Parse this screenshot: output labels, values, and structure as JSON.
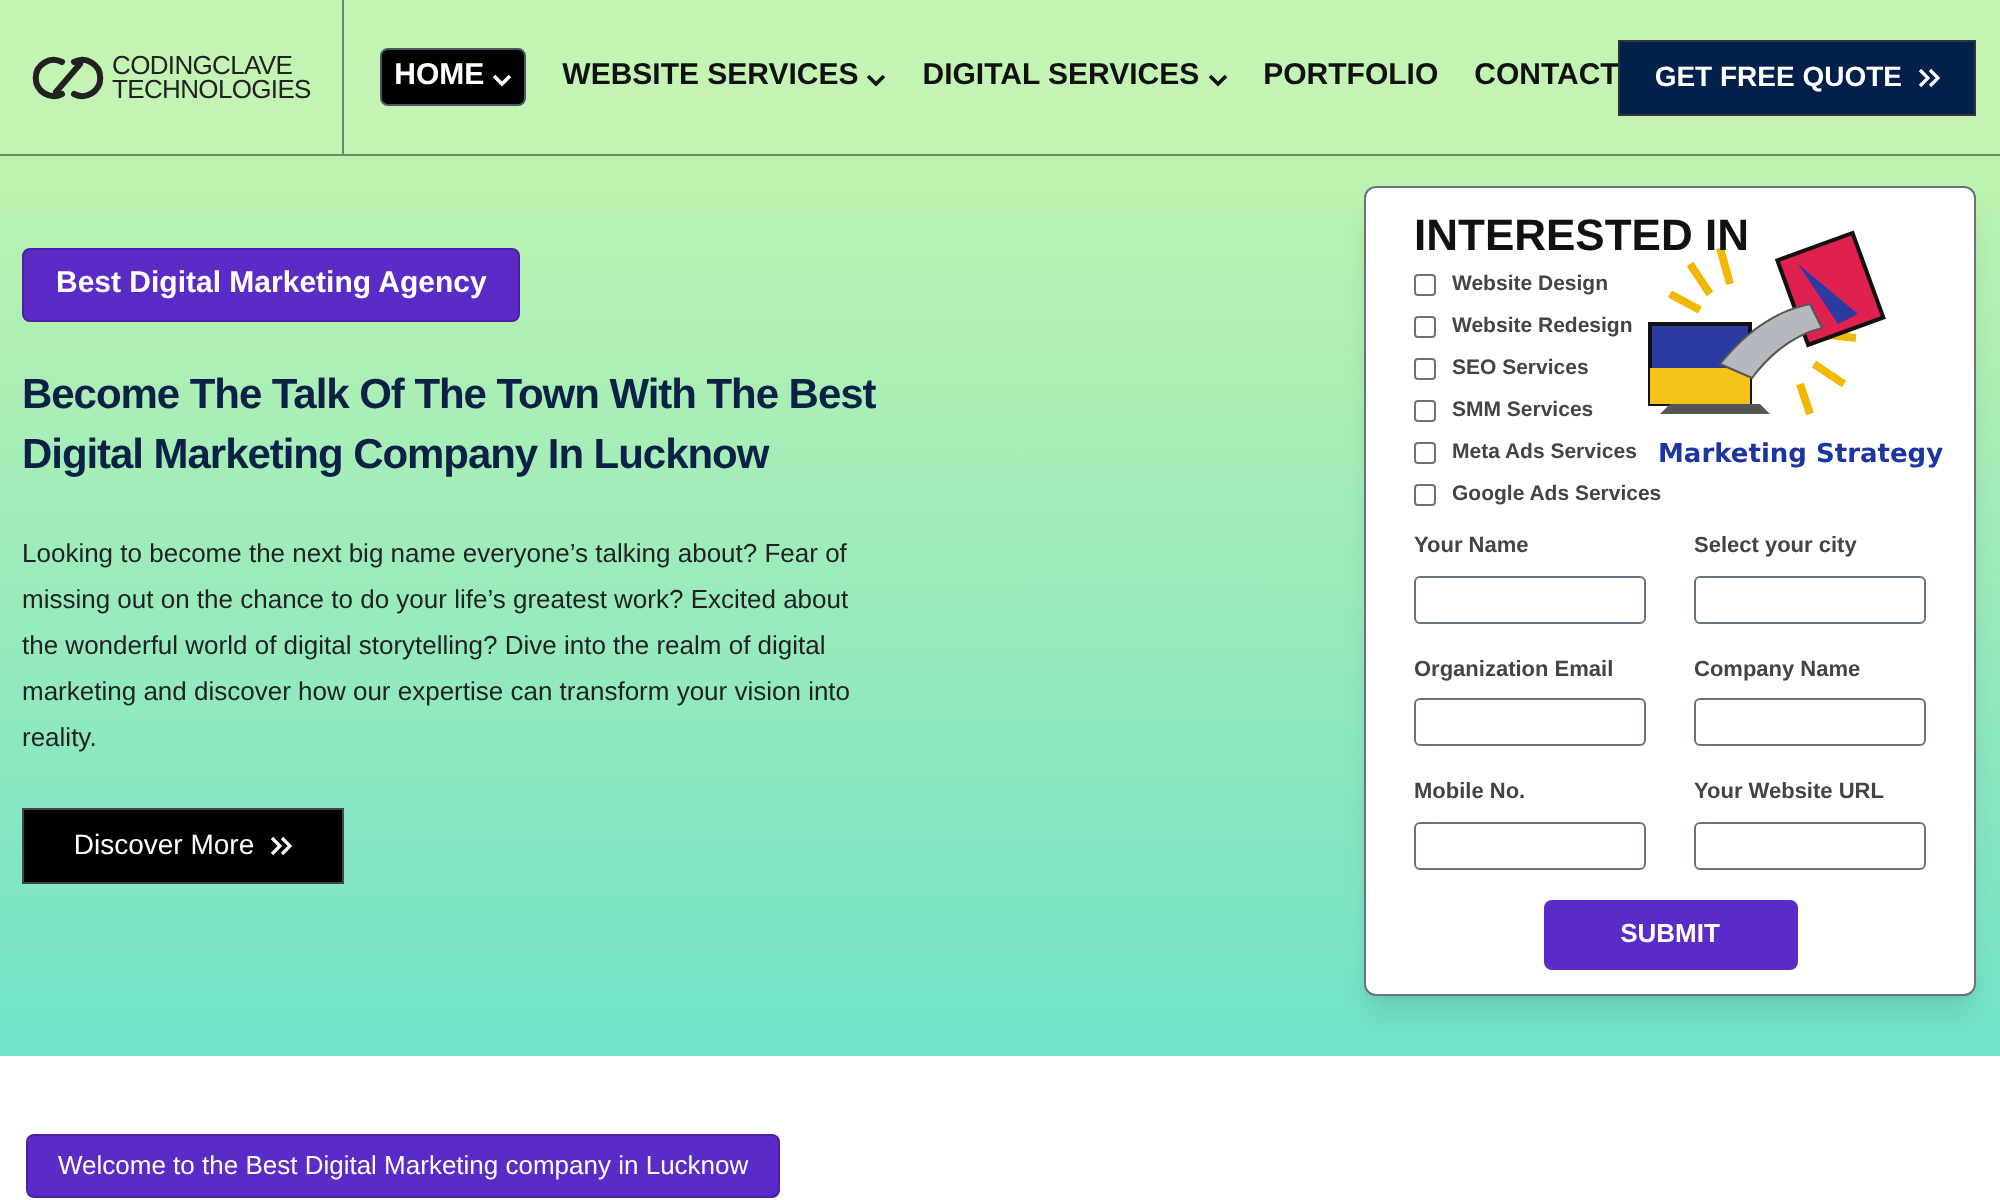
{
  "logo": {
    "line1": "CODINGCLAVE",
    "line2": "TECHNOLOGIES"
  },
  "nav": [
    {
      "label": "HOME",
      "selected": true,
      "dropdown": true
    },
    {
      "label": "WEBSITE SERVICES",
      "selected": false,
      "dropdown": true
    },
    {
      "label": "DIGITAL SERVICES",
      "selected": false,
      "dropdown": true
    },
    {
      "label": "PORTFOLIO",
      "selected": false,
      "dropdown": false
    },
    {
      "label": "CONTACT",
      "selected": false,
      "dropdown": false
    }
  ],
  "quote_button": "GET FREE QUOTE",
  "hero": {
    "badge": "Best Digital Marketing Agency",
    "heading": "Become The Talk Of The Town With The Best Digital Marketing Company In Lucknow",
    "body": "Looking to become the next big name everyone’s talking about? Fear of missing out on the chance to do your life’s greatest work? Excited about the wonderful world of digital storytelling? Dive into the realm of digital marketing and discover how our expertise can transform your vision into reality.",
    "button": "Discover More"
  },
  "form": {
    "title": "INTERESTED IN",
    "illustration_caption": "Marketing Strategy",
    "options": [
      {
        "label": "Website Design",
        "checked": false
      },
      {
        "label": "Website Redesign",
        "checked": false
      },
      {
        "label": "SEO Services",
        "checked": false
      },
      {
        "label": "SMM Services",
        "checked": false
      },
      {
        "label": "Meta Ads Services",
        "checked": false
      },
      {
        "label": "Google Ads Services",
        "checked": false
      }
    ],
    "fields": [
      {
        "label": "Your Name"
      },
      {
        "label": "Select your city"
      },
      {
        "label": "Organization Email"
      },
      {
        "label": "Company Name"
      },
      {
        "label": "Mobile No."
      },
      {
        "label": "Your Website URL"
      }
    ],
    "submit": "SUBMIT"
  },
  "welcome_button": "Welcome to the Best Digital Marketing company in Lucknow"
}
